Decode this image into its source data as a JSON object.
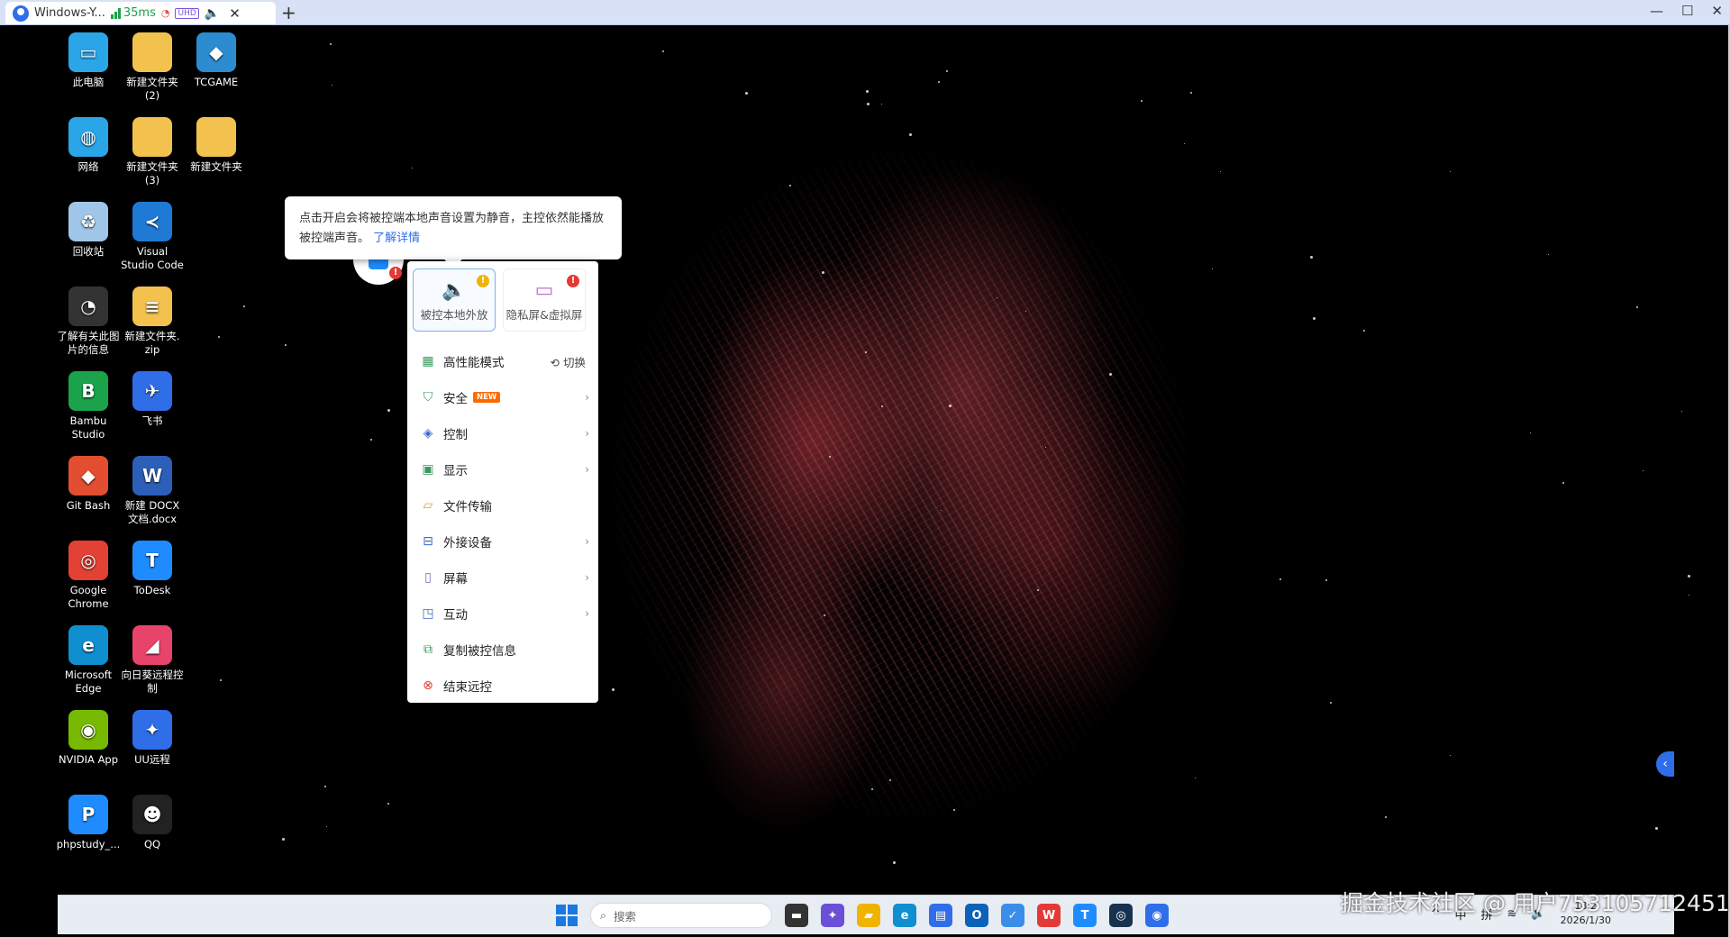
{
  "topbar": {
    "tab_title": "Windows-Y...",
    "latency": "35ms",
    "quality_badge": "UHD",
    "close": "✕",
    "add": "+",
    "minimize": "—",
    "maximize": "☐",
    "window_close": "✕"
  },
  "desktop_icons": [
    {
      "label": "此电脑",
      "icon": "monitor-icon"
    },
    {
      "label": "新建文件夹\n(2)",
      "icon": "folder-icon"
    },
    {
      "label": "TCGAME",
      "icon": "tcgame-icon"
    },
    {
      "label": "网络",
      "icon": "network-icon"
    },
    {
      "label": "新建文件夹\n(3)",
      "icon": "folder-icon"
    },
    {
      "label": "新建文件夹",
      "icon": "folder-icon"
    },
    {
      "label": "回收站",
      "icon": "recycle-bin-icon"
    },
    {
      "label": "Visual\nStudio Code",
      "icon": "vscode-icon"
    },
    {
      "label": "了解有关此图\n片的信息",
      "icon": "info-icon"
    },
    {
      "label": "新建文件夹.\nzip",
      "icon": "zip-folder-icon"
    },
    {
      "label": "Bambu\nStudio",
      "icon": "bambu-icon"
    },
    {
      "label": "飞书",
      "icon": "feishu-icon"
    },
    {
      "label": "Git Bash",
      "icon": "git-icon"
    },
    {
      "label": "新建 DOCX\n文档.docx",
      "icon": "word-doc-icon"
    },
    {
      "label": "Google\nChrome",
      "icon": "chrome-icon"
    },
    {
      "label": "ToDesk",
      "icon": "todesk-icon"
    },
    {
      "label": "Microsoft\nEdge",
      "icon": "edge-icon"
    },
    {
      "label": "向日葵远程控\n制",
      "icon": "sunlogin-icon"
    },
    {
      "label": "NVIDIA App",
      "icon": "nvidia-icon"
    },
    {
      "label": "UU远程",
      "icon": "uu-remote-icon"
    },
    {
      "label": "phpstudy_...",
      "icon": "phpstudy-icon"
    },
    {
      "label": "QQ",
      "icon": "qq-icon"
    }
  ],
  "tooltip": {
    "text": "点击开启会将被控端本地声音设置为静音，主控依然能播放被控端声音。",
    "link": "了解详情"
  },
  "menu": {
    "cards": [
      {
        "label": "被控本地外放",
        "icon": "speaker-icon",
        "badge": "!"
      },
      {
        "label": "隐私屏&虚拟屏",
        "icon": "privacy-screen-icon",
        "badge": "!"
      }
    ],
    "items": [
      {
        "label": "高性能模式",
        "icon": "grid-icon",
        "extra": "切换"
      },
      {
        "label": "安全",
        "icon": "shield-icon",
        "badge": "NEW"
      },
      {
        "label": "控制",
        "icon": "layers-icon"
      },
      {
        "label": "显示",
        "icon": "display-icon"
      },
      {
        "label": "文件传输",
        "icon": "folder-outline-icon"
      },
      {
        "label": "外接设备",
        "icon": "peripheral-icon"
      },
      {
        "label": "屏幕",
        "icon": "screen-icon"
      },
      {
        "label": "互动",
        "icon": "chat-icon"
      },
      {
        "label": "复制被控信息",
        "icon": "copy-icon"
      },
      {
        "label": "结束远控",
        "icon": "end-icon"
      }
    ]
  },
  "taskbar": {
    "search_placeholder": "搜索",
    "tray_ime_lang": "中",
    "tray_ime_mode": "拼",
    "time": "18:2",
    "date": "2026/1/30"
  },
  "watermark": "掘金技术社区 @ 用户753105712451",
  "colors": {
    "accent": "#2f6ee8",
    "warn_yellow": "#f0b400",
    "warn_red": "#e53935",
    "new_badge": "#ff6a00",
    "nebula": "#c84a55"
  }
}
